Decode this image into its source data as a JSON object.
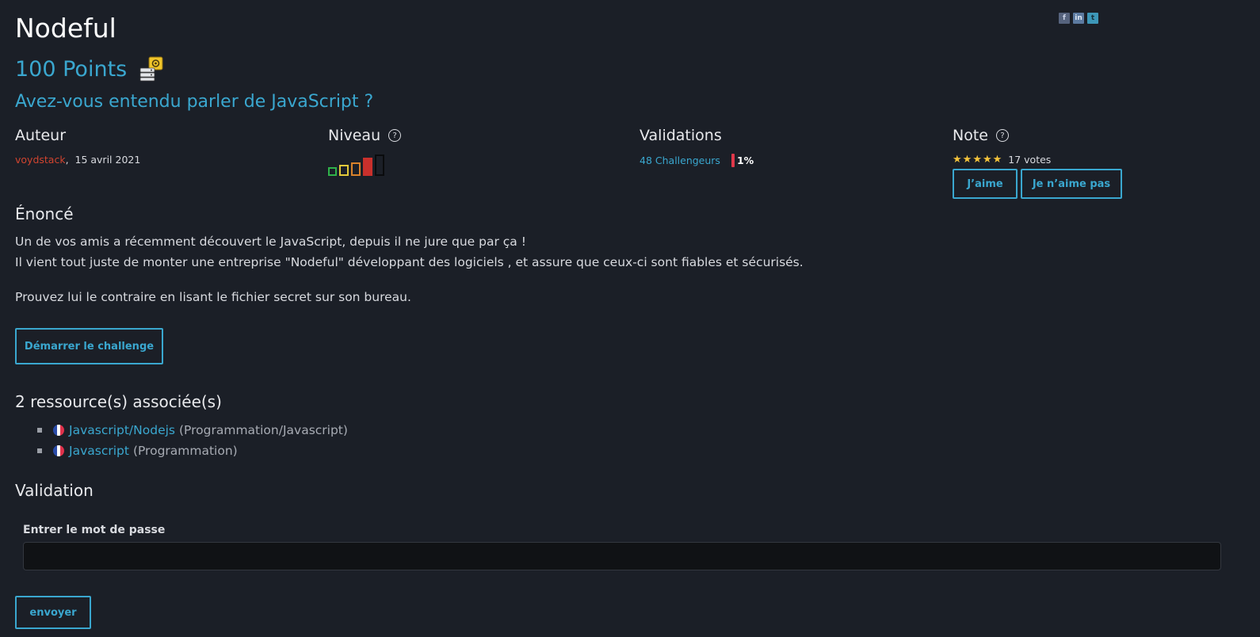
{
  "share": {
    "facebook_icon": "facebook-icon",
    "linkedin_icon": "linkedin-icon",
    "twitter_icon": "twitter-icon"
  },
  "challenge": {
    "title": "Nodeful",
    "points": "100 Points",
    "category_icon": "server-gear-icon",
    "subtitle": "Avez-vous entendu parler de JavaScript ?"
  },
  "author": {
    "heading": "Auteur",
    "name": "voydstack",
    "separator": ",",
    "date": "15 avril 2021"
  },
  "level": {
    "heading": "Niveau",
    "help_icon": "help-icon",
    "difficulty": 4,
    "max": 5,
    "colors": [
      "#2fb24a",
      "#e3c93a",
      "#d9822b",
      "#c9302c",
      "#0d0f12"
    ]
  },
  "validations": {
    "heading": "Validations",
    "challengers": "48 Challengeurs",
    "percent": "1%"
  },
  "note": {
    "heading": "Note",
    "help_icon": "help-icon",
    "stars": 5,
    "votes": "17 votes",
    "like": "J’aime",
    "dislike": "Je n’aime pas"
  },
  "statement": {
    "heading": "Énoncé",
    "line1": "Un de vos amis a récemment découvert le JavaScript, depuis il ne jure que par ça !",
    "line2": "Il vient tout juste de monter une entreprise \"Nodeful\" développant des logiciels , et assure que ceux-ci sont fiables et sécurisés.",
    "line3": "Prouvez lui le contraire en lisant le fichier secret sur son bureau.",
    "start_button": "Démarrer le challenge"
  },
  "resources": {
    "heading": "2 ressource(s) associée(s)",
    "items": [
      {
        "title": "Javascript/Nodejs",
        "category": "(Programmation/Javascript)",
        "flag": "fr-flag-icon"
      },
      {
        "title": "Javascript",
        "category": "(Programmation)",
        "flag": "fr-flag-icon"
      }
    ]
  },
  "validation": {
    "heading": "Validation",
    "label": "Entrer le mot de passe",
    "value": "",
    "submit": "envoyer"
  }
}
